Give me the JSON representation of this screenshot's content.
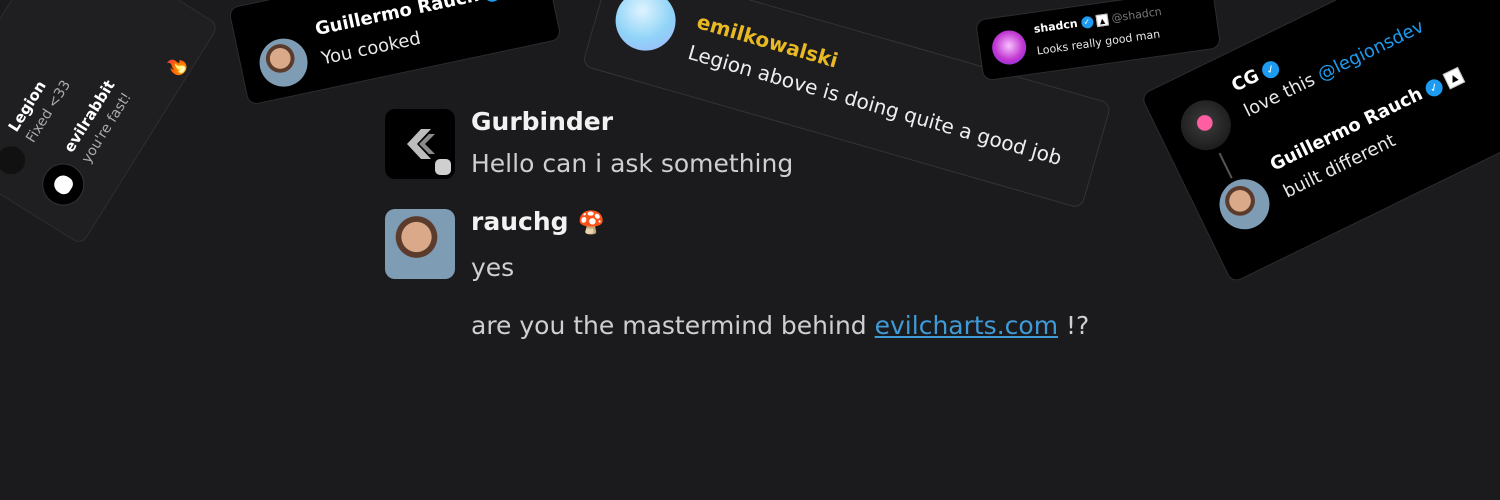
{
  "cards": {
    "legion_card": {
      "legion_name": "Legion",
      "legion_msg": "Fixed <33",
      "evilrabbit_name": "evilrabbit",
      "evilrabbit_msg": "you're fast!",
      "reaction_emoji": "🔥"
    },
    "rauch_card": {
      "name": "Guillermo Rauch",
      "message": "You cooked",
      "badge_glyph": "▲"
    },
    "emil_card": {
      "name": "emilkowalski",
      "message": "Legion above is doing quite a good job"
    },
    "shadcn_card": {
      "name": "shadcn",
      "handle": "@shadcn",
      "message": "Looks really good man",
      "badge_glyph": "▲"
    },
    "cg_card": {
      "cg_name": "CG",
      "cg_message_prefix": "love this ",
      "cg_mention": "@legionsdev",
      "rauch_name": "Guillermo Rauch",
      "rauch_message": "built different",
      "badge_glyph": "▲"
    }
  },
  "chat": {
    "messages": [
      {
        "author": "Gurbinder",
        "lines": [
          "Hello can i ask something"
        ]
      },
      {
        "author": "rauchg",
        "author_emoji": "🍄",
        "lines": [
          "yes"
        ],
        "line2_prefix": "are you the mastermind behind ",
        "line2_link": "evilcharts.com",
        "line2_suffix": " !?"
      }
    ]
  },
  "colors": {
    "background": "#1b1b1e",
    "link": "#3f9ad6",
    "emil_name": "#e8b923",
    "verified": "#1d9bf0",
    "mention": "#1d9bf0"
  },
  "icons": {
    "verified": "verified-check-icon",
    "vercel": "vercel-triangle-icon"
  }
}
